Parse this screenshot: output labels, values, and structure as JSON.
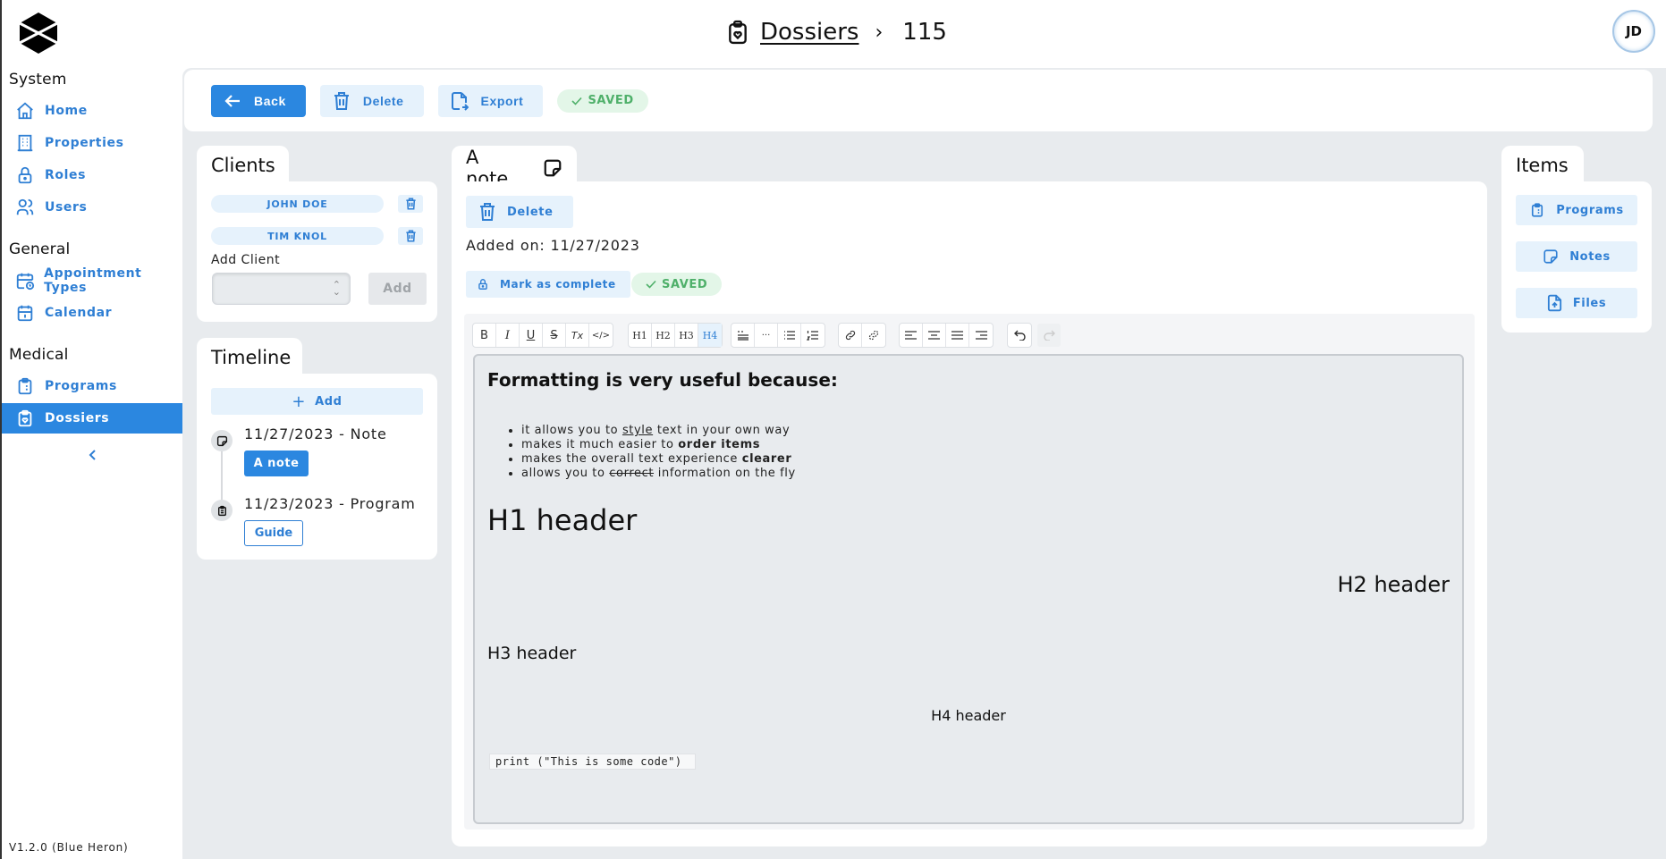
{
  "app": {
    "version": "V1.2.0 (Blue Heron)"
  },
  "sidebar": {
    "sections": [
      {
        "title": "System",
        "items": [
          {
            "label": "Home",
            "icon": "home-icon"
          },
          {
            "label": "Properties",
            "icon": "building-icon"
          },
          {
            "label": "Roles",
            "icon": "lock-icon"
          },
          {
            "label": "Users",
            "icon": "users-icon"
          }
        ]
      },
      {
        "title": "General",
        "items": [
          {
            "label": "Appointment Types",
            "icon": "calendar-clock-icon"
          },
          {
            "label": "Calendar",
            "icon": "calendar-icon"
          }
        ]
      },
      {
        "title": "Medical",
        "items": [
          {
            "label": "Programs",
            "icon": "clipboard-list-icon"
          },
          {
            "label": "Dossiers",
            "icon": "clipboard-heart-icon",
            "active": true
          }
        ]
      }
    ],
    "collapse_icon": "chevron-left-icon"
  },
  "header": {
    "breadcrumb": {
      "icon": "clipboard-heart-icon",
      "parent": "Dossiers",
      "separator": "›",
      "current": "115"
    },
    "avatar_initials": "JD"
  },
  "toolbar": {
    "back_label": "Back",
    "delete_label": "Delete",
    "export_label": "Export",
    "status": "SAVED"
  },
  "clients": {
    "title": "Clients",
    "list": [
      {
        "name": "JOHN DOE"
      },
      {
        "name": "TIM KNOL"
      }
    ],
    "add_client_label": "Add Client",
    "select_value": "",
    "add_button": "Add"
  },
  "timeline": {
    "title": "Timeline",
    "add_label": "Add",
    "entries": [
      {
        "date": "11/27/2023 - Note",
        "button": "A note",
        "icon": "sticky-note-icon"
      },
      {
        "date": "11/23/2023 - Program",
        "button": "Guide",
        "icon": "clipboard-list-icon"
      }
    ]
  },
  "note": {
    "title": "A note",
    "delete_label": "Delete",
    "added_on": "Added on: 11/27/2023",
    "mark_complete_label": "Mark as complete",
    "status": "SAVED",
    "editor": {
      "toolbar": {
        "format": [
          "B",
          "I",
          "U",
          "S",
          "Tx",
          "</>"
        ],
        "headings": [
          "H1",
          "H2",
          "H3",
          "H4"
        ],
        "active_heading": "H4"
      },
      "content": {
        "intro": "Formatting is very useful because:",
        "bullets": [
          {
            "pre": "it allows you to ",
            "mark": "style",
            "post": " text in your own way"
          },
          {
            "pre": "makes it much easier to ",
            "mark": "order items",
            "post": ""
          },
          {
            "pre": "makes the overall text experience ",
            "mark": "clearer",
            "post": ""
          },
          {
            "pre": "allows you to ",
            "mark": "correct",
            "post": " information on the fly"
          }
        ],
        "h1": "H1 header",
        "h2": "H2 header",
        "h3": "H3 header",
        "h4": "H4 header",
        "code": "print (\"This is some code\")"
      }
    }
  },
  "items": {
    "title": "Items",
    "buttons": [
      {
        "label": "Programs",
        "icon": "clipboard-list-icon"
      },
      {
        "label": "Notes",
        "icon": "sticky-note-icon"
      },
      {
        "label": "Files",
        "icon": "file-upload-icon"
      }
    ]
  }
}
